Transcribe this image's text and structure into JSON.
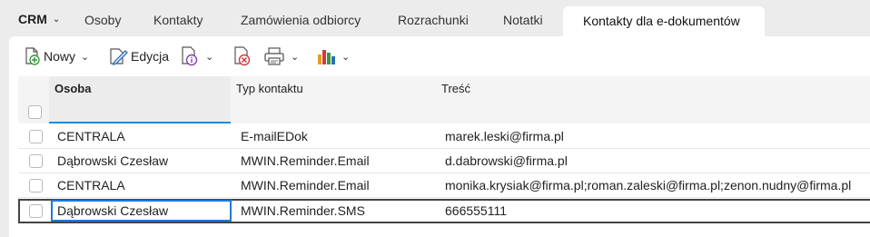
{
  "nav": {
    "menu_label": "CRM",
    "tabs": [
      {
        "label": "Osoby"
      },
      {
        "label": "Kontakty"
      },
      {
        "label": "Zamówienia odbiorcy"
      },
      {
        "label": "Rozrachunki"
      },
      {
        "label": "Notatki"
      },
      {
        "label": "Kontakty dla e-dokumentów"
      }
    ],
    "active_tab": "Kontakty dla e-dokumentów"
  },
  "toolbar": {
    "new_label": "Nowy",
    "edit_label": "Edycja",
    "icons": [
      "add-document-icon",
      "edit-document-icon",
      "document-info-icon",
      "delete-document-icon",
      "print-icon",
      "chart-icon"
    ]
  },
  "grid": {
    "columns": [
      "Osoba",
      "Typ kontaktu",
      "Treść"
    ],
    "rows": [
      {
        "osoba": "CENTRALA",
        "typ": "E-mailEDok",
        "tresc": "marek.leski@firma.pl"
      },
      {
        "osoba": "Dąbrowski Czesław",
        "typ": "MWIN.Reminder.Email",
        "tresc": "d.dabrowski@firma.pl"
      },
      {
        "osoba": "CENTRALA",
        "typ": "MWIN.Reminder.Email",
        "tresc": "monika.krysiak@firma.pl;roman.zaleski@firma.pl;zenon.nudny@firma.pl"
      },
      {
        "osoba": "Dąbrowski Czesław",
        "typ": "MWIN.Reminder.SMS",
        "tresc": "666555111"
      }
    ],
    "selected_row": 4
  },
  "colors": {
    "accent": "#1a8be0",
    "selection_border": "#444444",
    "focus_cell": "#1d7ad6",
    "background": "#ececec"
  }
}
